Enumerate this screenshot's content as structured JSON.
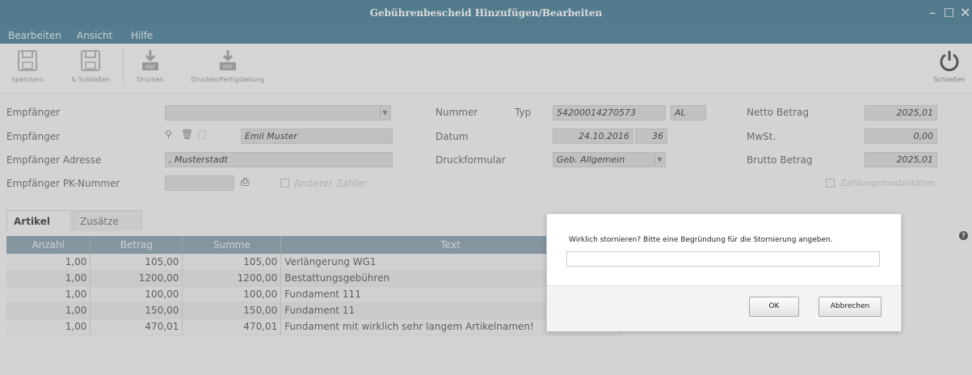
{
  "window": {
    "title": "Gebührenbescheid Hinzufügen/Bearbeiten",
    "controls": [
      "minimize-icon",
      "maximize-icon",
      "close-icon"
    ]
  },
  "menubar": {
    "items": [
      "Bearbeiten",
      "Ansicht",
      "Hilfe"
    ]
  },
  "toolbar": {
    "buttons": [
      {
        "label": "Speichern",
        "icon": "save-icon"
      },
      {
        "label": "& Schließen",
        "icon": "save-close-icon"
      },
      {
        "label": "Drucken",
        "icon": "download-pdf-icon"
      },
      {
        "label": "Drucken/Fertigstellung",
        "icon": "download-pdf-icon"
      }
    ],
    "exit_label": "Schließen",
    "exit_icon": "power-icon"
  },
  "form": {
    "empfaenger_label": "Empfänger",
    "empfaenger2_label": "Empfänger",
    "empfaenger_name": "Emil Muster",
    "adresse_label": "Empfänger Adresse",
    "adresse_value": ", Musterstadt",
    "pk_label": "Empfänger PK-Nummer",
    "anderer_zahler_label": "Anderer Zahler",
    "nummer_label": "Nummer",
    "typ_label": "Typ",
    "nummer_value": "54200014270573",
    "typ_value": "AL",
    "datum_label": "Datum",
    "datum_value": "24.10.2016",
    "datum_extra": "36",
    "druckformular_label": "Druckformular",
    "druckformular_value": "Geb. Allgemein",
    "netto_label": "Netto Betrag",
    "netto_value": "2025,01",
    "mwst_label": "MwSt.",
    "mwst_value": "0,00",
    "brutto_label": "Brutto Betrag",
    "brutto_value": "2025,01",
    "zahlung_label": "Zahlungsmodalitäten"
  },
  "tabs": [
    "Artikel",
    "Zusätze"
  ],
  "table": {
    "headers": [
      "Anzahl",
      "Betrag",
      "Summe",
      "Text"
    ],
    "rows": [
      [
        "1,00",
        "105,00",
        "105,00",
        "Verlängerung WG1"
      ],
      [
        "1,00",
        "1200,00",
        "1200,00",
        "Bestattungsgebühren"
      ],
      [
        "1,00",
        "100,00",
        "100,00",
        "Fundament 111"
      ],
      [
        "1,00",
        "150,00",
        "150,00",
        "Fundament 11"
      ],
      [
        "1,00",
        "470,01",
        "470,01",
        "Fundament mit wirklich sehr langem Artikelnamen!"
      ]
    ]
  },
  "dialog": {
    "message": "Wirklich stornieren? Bitte eine Begründung für die Stornierung angeben.",
    "input_value": "",
    "ok_label": "OK",
    "cancel_label": "Abbrechen"
  },
  "colors": {
    "titlebar": "#2f6f8a",
    "table_header": "#7d96a6",
    "field_bg": "#d9d9d9"
  }
}
